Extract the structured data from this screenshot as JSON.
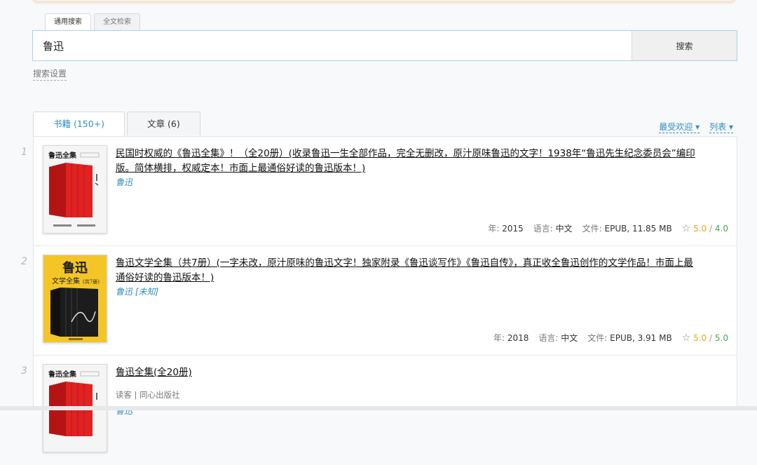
{
  "search": {
    "tabs": [
      "通用搜索",
      "全文检索"
    ],
    "query": "鲁迅",
    "button": "搜索",
    "settings_link": "搜索设置"
  },
  "result_tabs": [
    {
      "label": "书籍 (150+)"
    },
    {
      "label": "文章 (6)"
    }
  ],
  "sort": {
    "order": "最受欢迎",
    "view": "列表",
    "caret": "▾"
  },
  "labels": {
    "year": "年:",
    "language": "语言:",
    "file": "文件:"
  },
  "colors": {
    "accent": "#2e8fbe",
    "rating_a": "#f0a020",
    "rating_b": "#4aa44a"
  },
  "results": [
    {
      "index": "1",
      "title": "民国时权威的《鲁迅全集》！（全20册）(收录鲁迅一生全部作品，完全无删改，原汁原味鲁迅的文字！1938年“鲁迅先生纪念委员会”编印版。简体横排，权威定本！市面上最通俗好读的鲁迅版本！)",
      "authors": "鲁迅",
      "year": "2015",
      "language": "中文",
      "file": "EPUB, 11.85 MB",
      "rating_a": "5.0",
      "rating_b": "4.0",
      "cover_icon": "book-cover-red-collection",
      "cover_title": "鲁迅全集"
    },
    {
      "index": "2",
      "title": "鲁迅文学全集（共7册）(一字未改，原汁原味的鲁迅文字！独家附录《鲁迅谈写作》《鲁迅自传》，真正收全鲁迅创作的文学作品！市面上最通俗好读的鲁迅版本！)",
      "authors": "鲁迅 [未知]",
      "year": "2018",
      "language": "中文",
      "file": "EPUB, 3.91 MB",
      "rating_a": "5.0",
      "rating_b": "5.0",
      "cover_icon": "book-cover-yellow-collection",
      "cover_title_1": "鲁迅",
      "cover_title_2": "文学全集",
      "cover_sub": "(共7册)"
    },
    {
      "index": "3",
      "title": "鲁迅全集(全20册)",
      "publisher": "读客 | 同心出版社",
      "authors": "鲁迅",
      "cover_icon": "book-cover-red-collection",
      "cover_title": "鲁迅全集"
    }
  ]
}
